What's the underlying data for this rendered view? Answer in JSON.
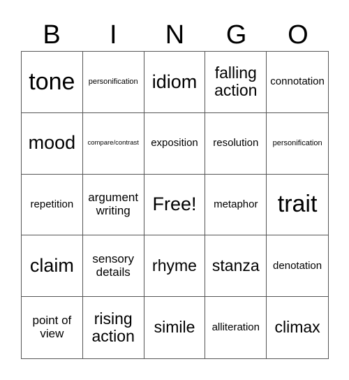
{
  "header": {
    "letters": [
      "B",
      "I",
      "N",
      "G",
      "O"
    ]
  },
  "grid": {
    "cells": [
      {
        "text": "tone",
        "size": "sz-xl"
      },
      {
        "text": "personification",
        "size": "sz-xs"
      },
      {
        "text": "idiom",
        "size": "sz-l"
      },
      {
        "text": "falling action",
        "size": "sz-ml"
      },
      {
        "text": "connotation",
        "size": "sz-s"
      },
      {
        "text": "mood",
        "size": "sz-l"
      },
      {
        "text": "compare/contrast",
        "size": "sz-xxs"
      },
      {
        "text": "exposition",
        "size": "sz-s"
      },
      {
        "text": "resolution",
        "size": "sz-s"
      },
      {
        "text": "personification",
        "size": "sz-xs"
      },
      {
        "text": "repetition",
        "size": "sz-s"
      },
      {
        "text": "argument writing",
        "size": "sz-m"
      },
      {
        "text": "Free!",
        "size": "sz-l"
      },
      {
        "text": "metaphor",
        "size": "sz-s"
      },
      {
        "text": "trait",
        "size": "sz-xl"
      },
      {
        "text": "claim",
        "size": "sz-l"
      },
      {
        "text": "sensory details",
        "size": "sz-m"
      },
      {
        "text": "rhyme",
        "size": "sz-ml"
      },
      {
        "text": "stanza",
        "size": "sz-ml"
      },
      {
        "text": "denotation",
        "size": "sz-s"
      },
      {
        "text": "point of view",
        "size": "sz-m"
      },
      {
        "text": "rising action",
        "size": "sz-ml"
      },
      {
        "text": "simile",
        "size": "sz-ml"
      },
      {
        "text": "alliteration",
        "size": "sz-s"
      },
      {
        "text": "climax",
        "size": "sz-ml"
      }
    ]
  }
}
